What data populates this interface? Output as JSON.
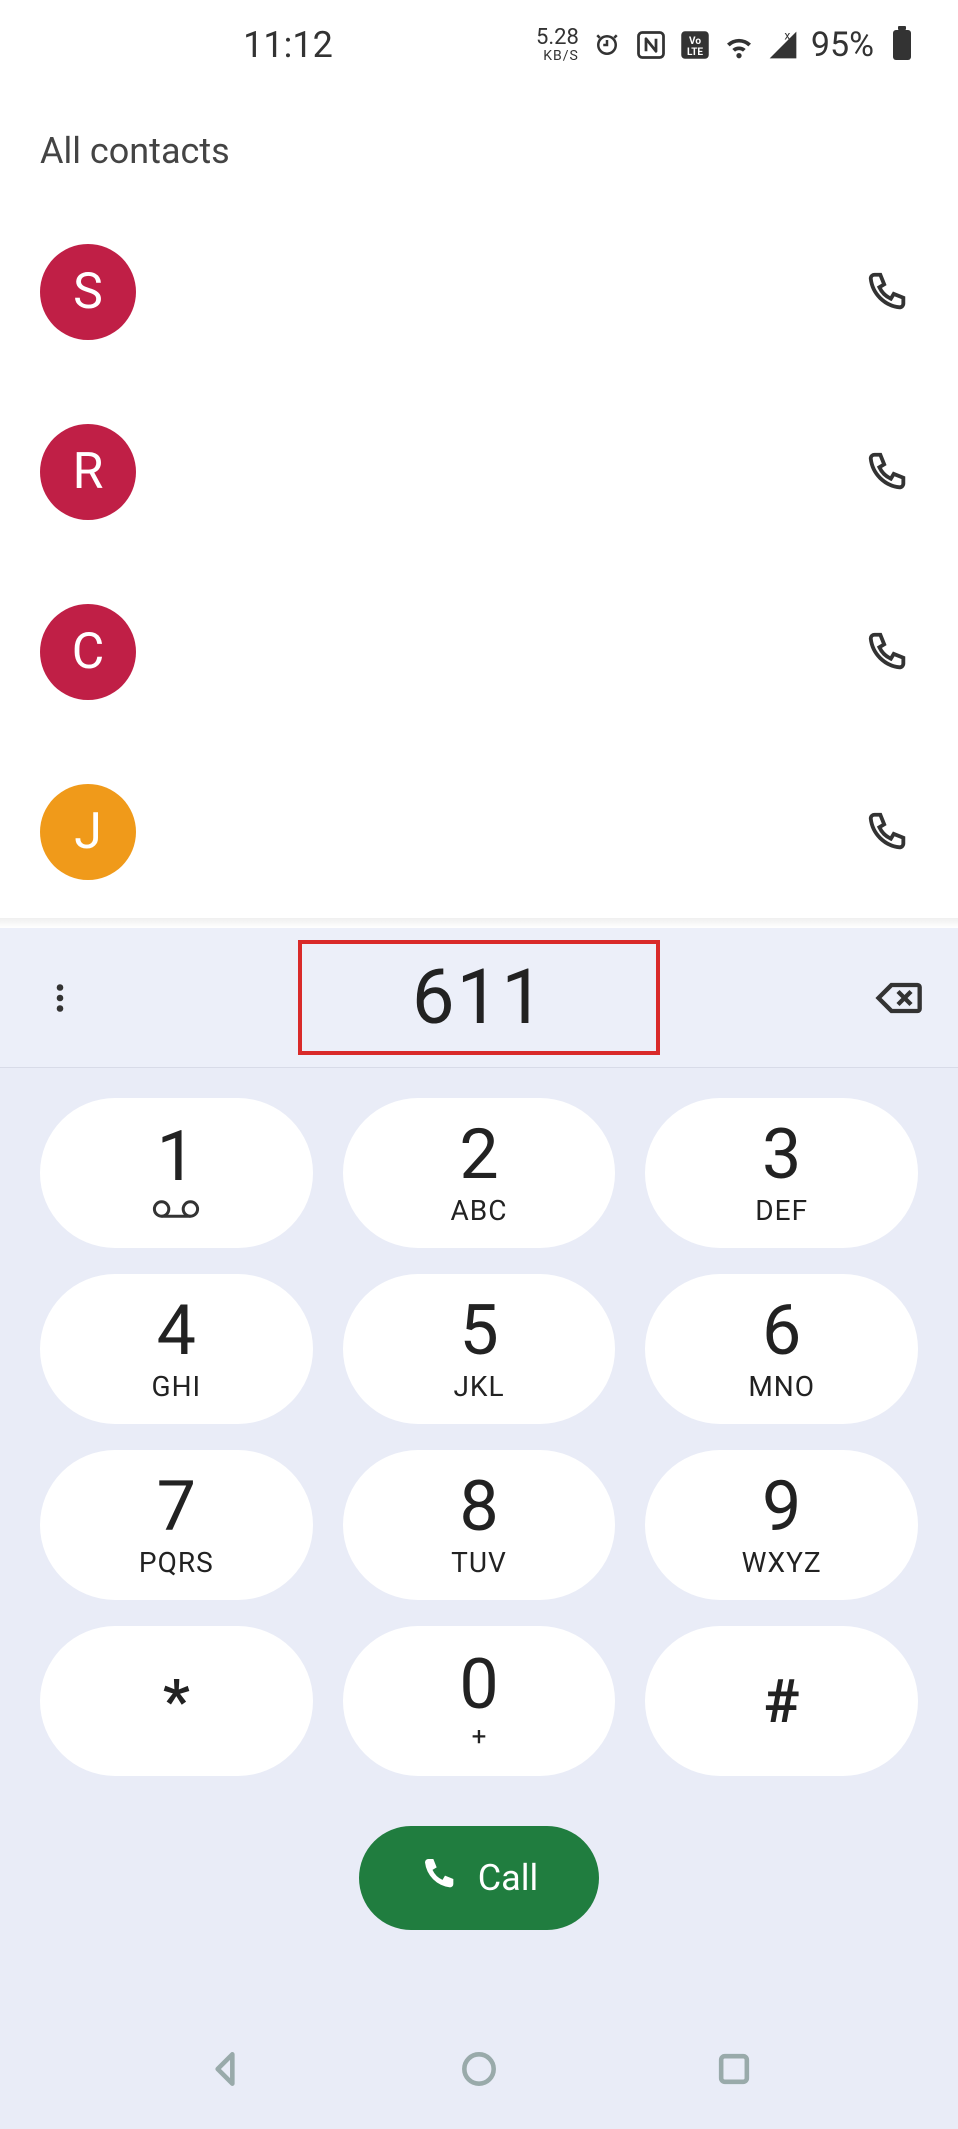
{
  "status": {
    "time": "11:12",
    "speed_value": "5.28",
    "speed_unit": "KB/S",
    "battery_pct": "95%"
  },
  "contacts": {
    "section_title": "All contacts",
    "items": [
      {
        "initial": "S",
        "color": "#c01f46"
      },
      {
        "initial": "R",
        "color": "#c01f46"
      },
      {
        "initial": "C",
        "color": "#c01f46"
      },
      {
        "initial": "J",
        "color": "#f09a1a"
      }
    ]
  },
  "dialer": {
    "entered_number": "611",
    "call_label": "Call",
    "keys": [
      [
        {
          "digit": "1",
          "letters": "",
          "vm": true
        },
        {
          "digit": "2",
          "letters": "ABC"
        },
        {
          "digit": "3",
          "letters": "DEF"
        }
      ],
      [
        {
          "digit": "4",
          "letters": "GHI"
        },
        {
          "digit": "5",
          "letters": "JKL"
        },
        {
          "digit": "6",
          "letters": "MNO"
        }
      ],
      [
        {
          "digit": "7",
          "letters": "PQRS"
        },
        {
          "digit": "8",
          "letters": "TUV"
        },
        {
          "digit": "9",
          "letters": "WXYZ"
        }
      ],
      [
        {
          "digit": "*",
          "letters": "",
          "sym": true
        },
        {
          "digit": "0",
          "letters": "+",
          "plus": true
        },
        {
          "digit": "#",
          "letters": "",
          "sym": true
        }
      ]
    ]
  }
}
